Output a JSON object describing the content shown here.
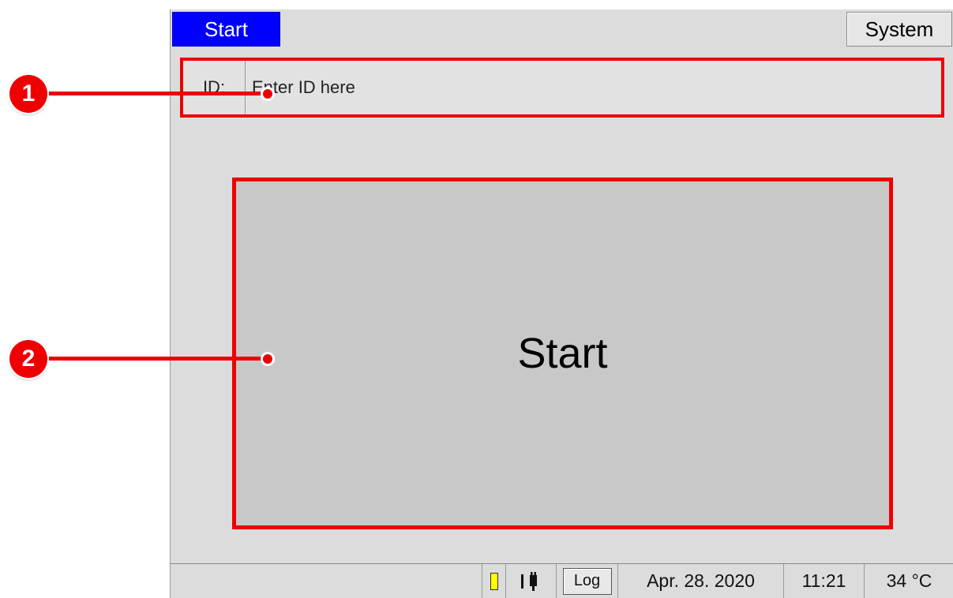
{
  "tabs": {
    "start_label": "Start",
    "system_label": "System"
  },
  "id_field": {
    "label": "ID:",
    "placeholder": "Enter ID here"
  },
  "main": {
    "start_button_label": "Start"
  },
  "statusbar": {
    "battery_color": "#ffff00",
    "power_icon": "plug-icon",
    "log_label": "Log",
    "date": "Apr. 28. 2020",
    "time": "11:21",
    "temperature": "34 °C"
  },
  "callouts": {
    "marker_1": "1",
    "marker_2": "2"
  },
  "colors": {
    "active_tab": "#0000ff",
    "highlight": "#ee0000"
  }
}
